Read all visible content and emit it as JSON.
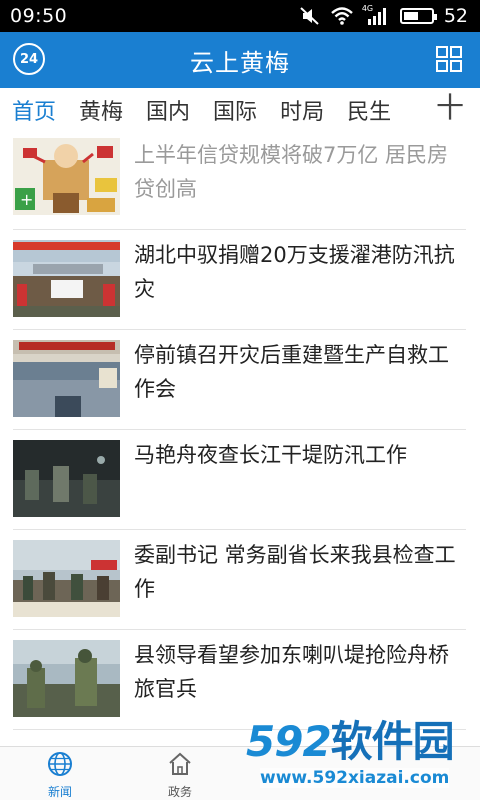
{
  "status_bar": {
    "time": "09:50",
    "network": "4G",
    "battery": "52",
    "battery_level": 0.52
  },
  "header": {
    "badge": "24",
    "title": "云上黄梅"
  },
  "tabs": [
    {
      "label": "首页",
      "active": true
    },
    {
      "label": "黄梅",
      "active": false
    },
    {
      "label": "国内",
      "active": false
    },
    {
      "label": "国际",
      "active": false
    },
    {
      "label": "时局",
      "active": false
    },
    {
      "label": "民生",
      "active": false
    }
  ],
  "tabs_plus": "十",
  "news": [
    {
      "headline": "上半年信贷规模将破7万亿 居民房贷创高",
      "thumb": "cartoon-finance"
    },
    {
      "headline": "湖北中驭捐赠20万支援濯港防汛抗灾",
      "thumb": "donation-group"
    },
    {
      "headline": "停前镇召开灾后重建暨生产自救工作会",
      "thumb": "meeting-room"
    },
    {
      "headline": "马艳舟夜查长江干堤防汛工作",
      "thumb": "night-inspection"
    },
    {
      "headline": "委副书记 常务副省长来我县检查工作",
      "thumb": "levee-workers"
    },
    {
      "headline": "县领导看望参加东喇叭堤抢险舟桥旅官兵",
      "thumb": "soldiers"
    }
  ],
  "bottom_nav": [
    {
      "label": "新闻",
      "icon": "globe-icon",
      "active": true
    },
    {
      "label": "政务",
      "icon": "home-icon",
      "active": false
    }
  ],
  "watermark": {
    "brand_num": "592",
    "brand_cn": "软件园",
    "url": "www.592xiazai.com"
  },
  "colors": {
    "primary": "#1a7fd1",
    "active_tab": "#1a7fd1",
    "read_headline": "#9a9a9a"
  }
}
